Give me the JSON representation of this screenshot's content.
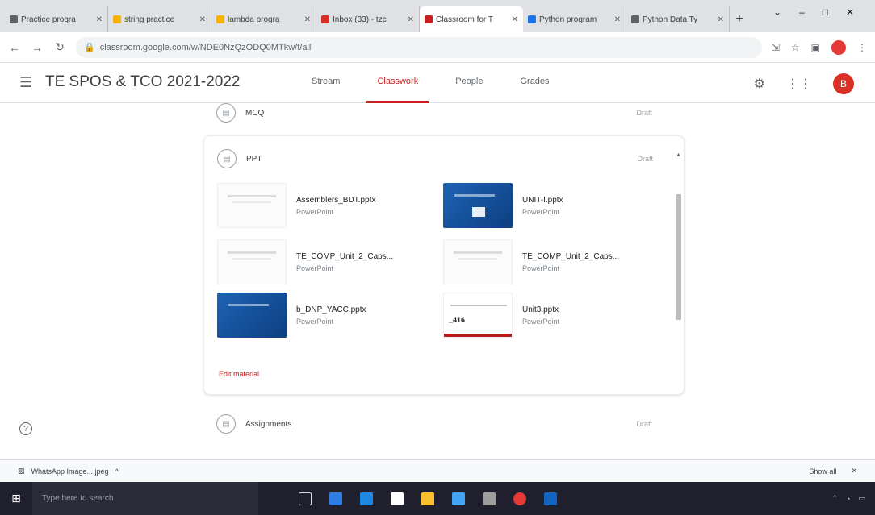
{
  "browser": {
    "tabs": [
      {
        "label": "Practice progra",
        "color": "#5f6368",
        "active": false
      },
      {
        "label": "string practice",
        "color": "#f4b400",
        "active": false
      },
      {
        "label": "lambda progra",
        "color": "#f4b400",
        "active": false
      },
      {
        "label": "Inbox (33) - tzc",
        "color": "#d93025",
        "active": false
      },
      {
        "label": "Classroom for T",
        "color": "#c5221f",
        "active": true
      },
      {
        "label": "Python program",
        "color": "#1a73e8",
        "active": false
      },
      {
        "label": "Python Data Ty",
        "color": "#5f6368",
        "active": false
      }
    ],
    "new_tab": "+",
    "url": "classroom.google.com/w/NDE0NzQzODQ0MTkw/t/all",
    "window_controls": [
      "⌄",
      "–",
      "□",
      "✕"
    ]
  },
  "classroom": {
    "class_name": "TE SPOS & TCO 2021-2022",
    "nav_tabs": [
      {
        "label": "Stream",
        "active": false
      },
      {
        "label": "Classwork",
        "active": true
      },
      {
        "label": "People",
        "active": false
      },
      {
        "label": "Grades",
        "active": false
      }
    ],
    "avatar_letter": "B",
    "topics": [
      {
        "label": "MCQ",
        "date": "Draft"
      },
      {
        "label": "PPT",
        "date": "Draft"
      },
      {
        "label": "Assignments",
        "date": "Draft"
      }
    ],
    "attachments": [
      {
        "title": "Assemblers_BDT.pptx",
        "type": "PowerPoint"
      },
      {
        "title": "UNIT-I.pptx",
        "type": "PowerPoint"
      },
      {
        "title": "TE_COMP_Unit_2_Caps...",
        "type": "PowerPoint"
      },
      {
        "title": "TE_COMP_Unit_2_Caps...",
        "type": "PowerPoint"
      },
      {
        "title": "b_DNP_YACC.pptx",
        "type": "PowerPoint"
      },
      {
        "title": "Unit3.pptx",
        "type": "PowerPoint"
      }
    ],
    "thumb_number": "_416",
    "edit_label": "Edit material"
  },
  "downloads": {
    "file": "WhatsApp Image....jpeg",
    "show_all": "Show all"
  },
  "taskbar": {
    "search_placeholder": "Type here to search"
  }
}
